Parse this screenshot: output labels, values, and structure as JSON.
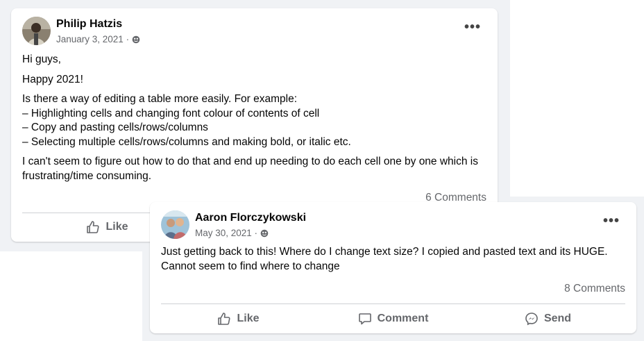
{
  "posts": [
    {
      "author": "Philip Hatzis",
      "date": "January 3, 2021 ·",
      "paragraphs": [
        "Hi guys,",
        "Happy 2021!",
        "Is there a way of editing a table more easily. For example:\n– Highlighting cells and changing font colour of contents of cell\n– Copy and pasting cells/rows/columns\n– Selecting multiple cells/rows/columns and making bold, or italic etc.",
        "I can't seem to figure out how to do that and end up needing to do each cell one by one which is frustrating/time consuming."
      ],
      "comments": "6 Comments",
      "like_label": "Like"
    },
    {
      "author": "Aaron Florczykowski",
      "date": "May 30, 2021 ·",
      "paragraphs": [
        "Just getting back to this! Where do I change text size? I copied and pasted text and its HUGE. Cannot seem to find where to change"
      ],
      "comments": "8 Comments",
      "like_label": "Like",
      "comment_label": "Comment",
      "send_label": "Send"
    }
  ],
  "icons": {
    "more": "more-options-icon",
    "audience": "globe-icon",
    "like": "thumbs-up-icon",
    "comment": "comment-bubble-icon",
    "send": "messenger-icon"
  },
  "colors": {
    "background": "#f0f2f5",
    "card": "#ffffff",
    "secondary_text": "#65676b",
    "primary_text": "#050505",
    "divider": "#ced0d4"
  }
}
